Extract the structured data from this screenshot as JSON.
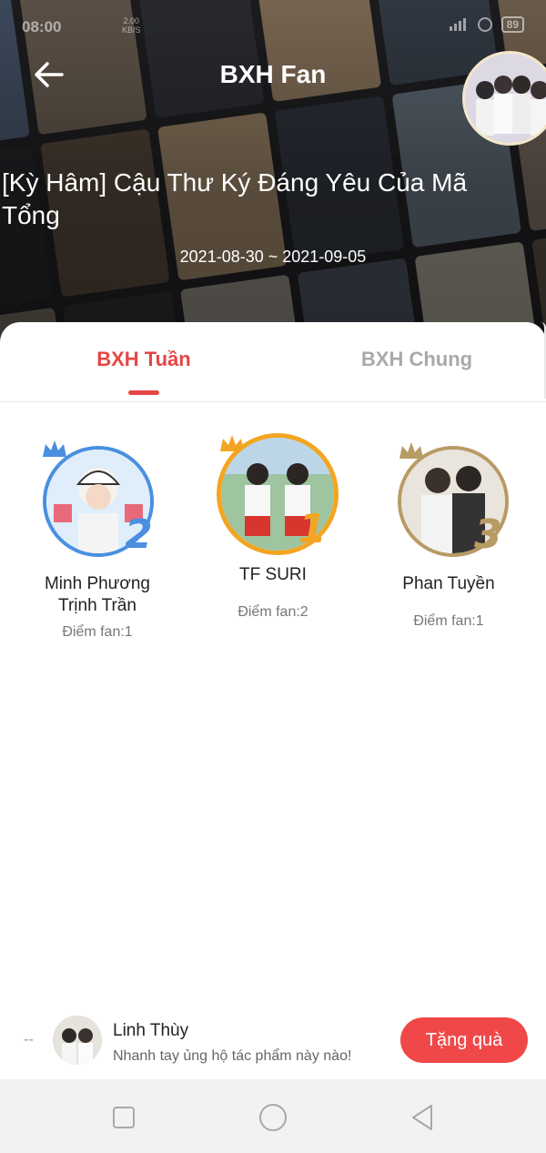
{
  "status_bar": {
    "time": "08:00",
    "net_speed": "2.00",
    "net_unit": "KB/S",
    "battery": "89"
  },
  "header": {
    "title": "BXH Fan",
    "work_title": "[Kỳ Hâm] Cậu Thư Ký Đáng Yêu Của Mã Tổng",
    "date_range": "2021-08-30 ~ 2021-09-05"
  },
  "tabs": [
    {
      "label": "BXH Tuần",
      "active": true
    },
    {
      "label": "BXH Chung",
      "active": false
    }
  ],
  "ranking": {
    "first": {
      "rank": "1",
      "name": "TF SURI",
      "score": "Điểm fan:2"
    },
    "second": {
      "rank": "2",
      "name": "Minh Phương Trịnh Trần",
      "score": "Điểm fan:1"
    },
    "third": {
      "rank": "3",
      "name": "Phan Tuyền",
      "score": "Điểm fan:1"
    }
  },
  "promo": {
    "dash": "--",
    "name": "Linh Thùy",
    "message": "Nhanh tay ủng hộ tác phẩm này nào!",
    "button_label": "Tặng quà"
  },
  "colors": {
    "accent": "#e64545",
    "inactive_tab": "#a9a9a9",
    "gift_button": "#f04848",
    "rank1": "#f3a521",
    "rank2": "#4a8fe0",
    "rank3": "#b89a63"
  },
  "icons": {
    "back": "arrow-left-icon",
    "nav_recent": "square-icon",
    "nav_home": "circle-icon",
    "nav_back": "triangle-icon"
  }
}
